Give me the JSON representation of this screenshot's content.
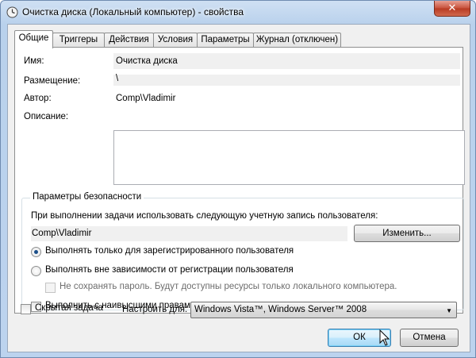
{
  "window": {
    "title": "Очистка диска (Локальный компьютер) - свойства",
    "close_label": "✕"
  },
  "tabs": [
    {
      "label": "Общие",
      "active": true
    },
    {
      "label": "Триггеры"
    },
    {
      "label": "Действия"
    },
    {
      "label": "Условия"
    },
    {
      "label": "Параметры"
    },
    {
      "label": "Журнал (отключен)"
    }
  ],
  "general": {
    "name_label": "Имя:",
    "name_value": "Очистка диска",
    "location_label": "Размещение:",
    "location_value": "\\",
    "author_label": "Автор:",
    "author_value": "Comp\\Vladimir",
    "description_label": "Описание:",
    "description_value": ""
  },
  "security": {
    "group_title": "Параметры безопасности",
    "account_prompt": "При выполнении задачи использовать следующую учетную запись пользователя:",
    "account_value": "Comp\\Vladimir",
    "change_button": "Изменить...",
    "radio_logged_on": "Выполнять только для зарегистрированного пользователя",
    "radio_logged_on_checked": true,
    "radio_any": "Выполнять вне зависимости от регистрации пользователя",
    "radio_any_checked": false,
    "no_store_password": "Не сохранять пароль. Будут доступны ресурсы только локального компьютера.",
    "highest_privileges": "Выполнить с наивысшими правами"
  },
  "bottom": {
    "hidden_task": "Скрытая задача",
    "configure_for_label": "Настроить для:",
    "configure_for_value": "Windows Vista™, Windows Server™ 2008"
  },
  "buttons": {
    "ok": "ОК",
    "cancel": "Отмена"
  },
  "colors": {
    "selected_radio": "#1b4f8a",
    "title_gradient": "#b9d1ec"
  }
}
